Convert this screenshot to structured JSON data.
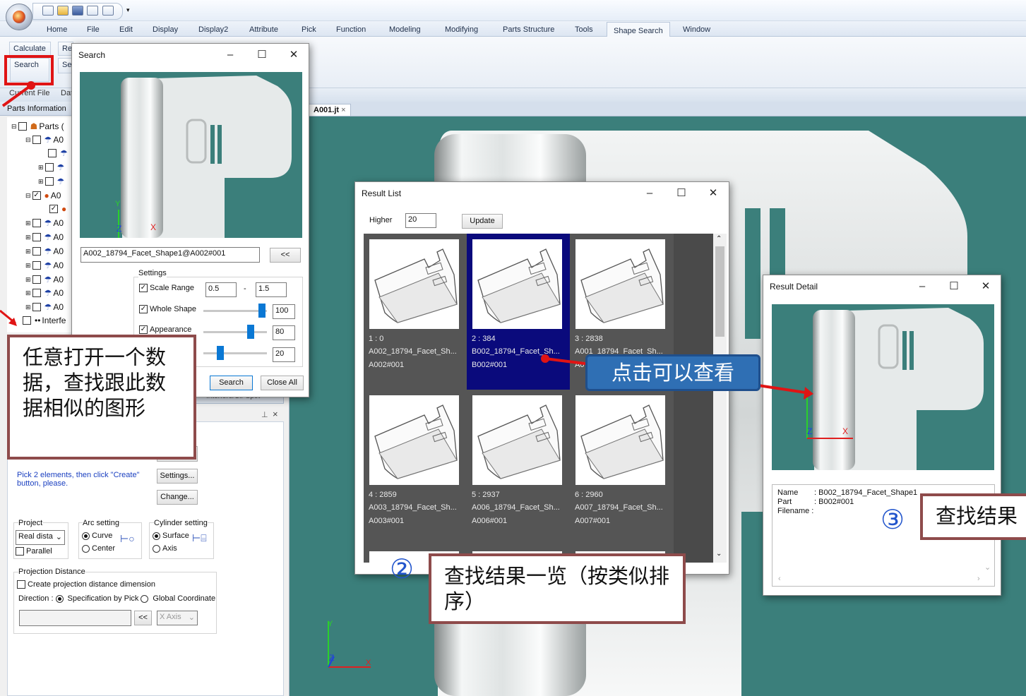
{
  "ribbon": {
    "tabs": [
      "Home",
      "File",
      "Edit",
      "Display",
      "Display2",
      "Attribute",
      "Pick",
      "Function",
      "Modeling",
      "Modifying",
      "Parts Structure",
      "Tools",
      "Shape Search",
      "Window"
    ],
    "active_tab": "Shape Search",
    "btn_calculate": "Calculate",
    "btn_re": "Re",
    "btn_search": "Search",
    "btn_se": "Se",
    "current_file": "Current File",
    "dat": "Dat"
  },
  "left_panel": {
    "parts_information": "Parts Information",
    "parts_root": "Parts (",
    "tree_prefix": "A0",
    "interfe": "Interfe",
    "hint": "Pick 2 elements, then click \"Create\" button, please.",
    "settings_btn": "Settings...",
    "change_btn": "Change...",
    "project_label": "Project",
    "project_value": "Real dista",
    "parallel": "Parallel",
    "arc_setting": "Arc setting",
    "curve": "Curve",
    "center": "Center",
    "cylinder_setting": "Cylinder setting",
    "surface": "Surface",
    "axis": "Axis",
    "projection_distance": "Projection Distance",
    "create_projection": "Create projection distance dimension",
    "direction": "Direction :",
    "spec_by_pick": "Specification by Pick",
    "global_coord": "Global Coordinate",
    "arrow_btn": "<<",
    "xaxis": "X Axis",
    "interfere_label": "Interfere/Cir Spot"
  },
  "search_dialog": {
    "title": "Search",
    "filename": "A002_18794_Facet_Shape1@A002#001",
    "collapse_btn": "<<",
    "settings": "Settings",
    "scale_range": "Scale Range",
    "scale_min": "0.5",
    "scale_dash": "-",
    "scale_max": "1.5",
    "whole_shape": "Whole Shape",
    "whole_val": "100",
    "appearance": "Appearance",
    "appearance_val": "80",
    "third_val": "20",
    "search_btn": "Search",
    "close_all_btn": "Close All",
    "whole_pct": 0.97,
    "appearance_pct": 0.78,
    "third_pct": 0.24
  },
  "doc_tab": "A001.jt",
  "result_list": {
    "title": "Result List",
    "higher_label": "Higher",
    "higher_value": "20",
    "update_btn": "Update",
    "items": [
      {
        "rank": "1 : 0",
        "name": "A002_18794_Facet_Sh...",
        "part": "A002#001"
      },
      {
        "rank": "2 : 384",
        "name": "B002_18794_Facet_Sh...",
        "part": "B002#001"
      },
      {
        "rank": "3 : 2838",
        "name": "A001_18794_Facet_Sh...",
        "part": "A0"
      },
      {
        "rank": "4 : 2859",
        "name": "A003_18794_Facet_Sh...",
        "part": "A003#001"
      },
      {
        "rank": "5 : 2937",
        "name": "A006_18794_Facet_Sh...",
        "part": "A006#001"
      },
      {
        "rank": "6 : 2960",
        "name": "A007_18794_Facet_Sh...",
        "part": "A007#001"
      }
    ]
  },
  "result_detail": {
    "title": "Result Detail",
    "name_label": "Name",
    "name_value": ": B002_18794_Facet_Shape1",
    "part_label": "Part",
    "part_value": ": B002#001",
    "filename_label": "Filename :"
  },
  "annotations": {
    "callout1": "任意打开一个数据，查找跟此数据相似的图形",
    "callout2_num": "②",
    "callout2": "查找结果一览（按类似排序）",
    "callout3_num": "③",
    "callout3": "查找结果",
    "click_to_view": "点击可以查看"
  },
  "axes": {
    "x": "X",
    "y": "Y",
    "z": "Z"
  },
  "colors": {
    "viewport": "#3b7f7b",
    "selected": "#0a0a7c",
    "callout_border": "#8e4b4b",
    "arrow_red": "#e01414",
    "click_blue": "#2f6fb4"
  }
}
